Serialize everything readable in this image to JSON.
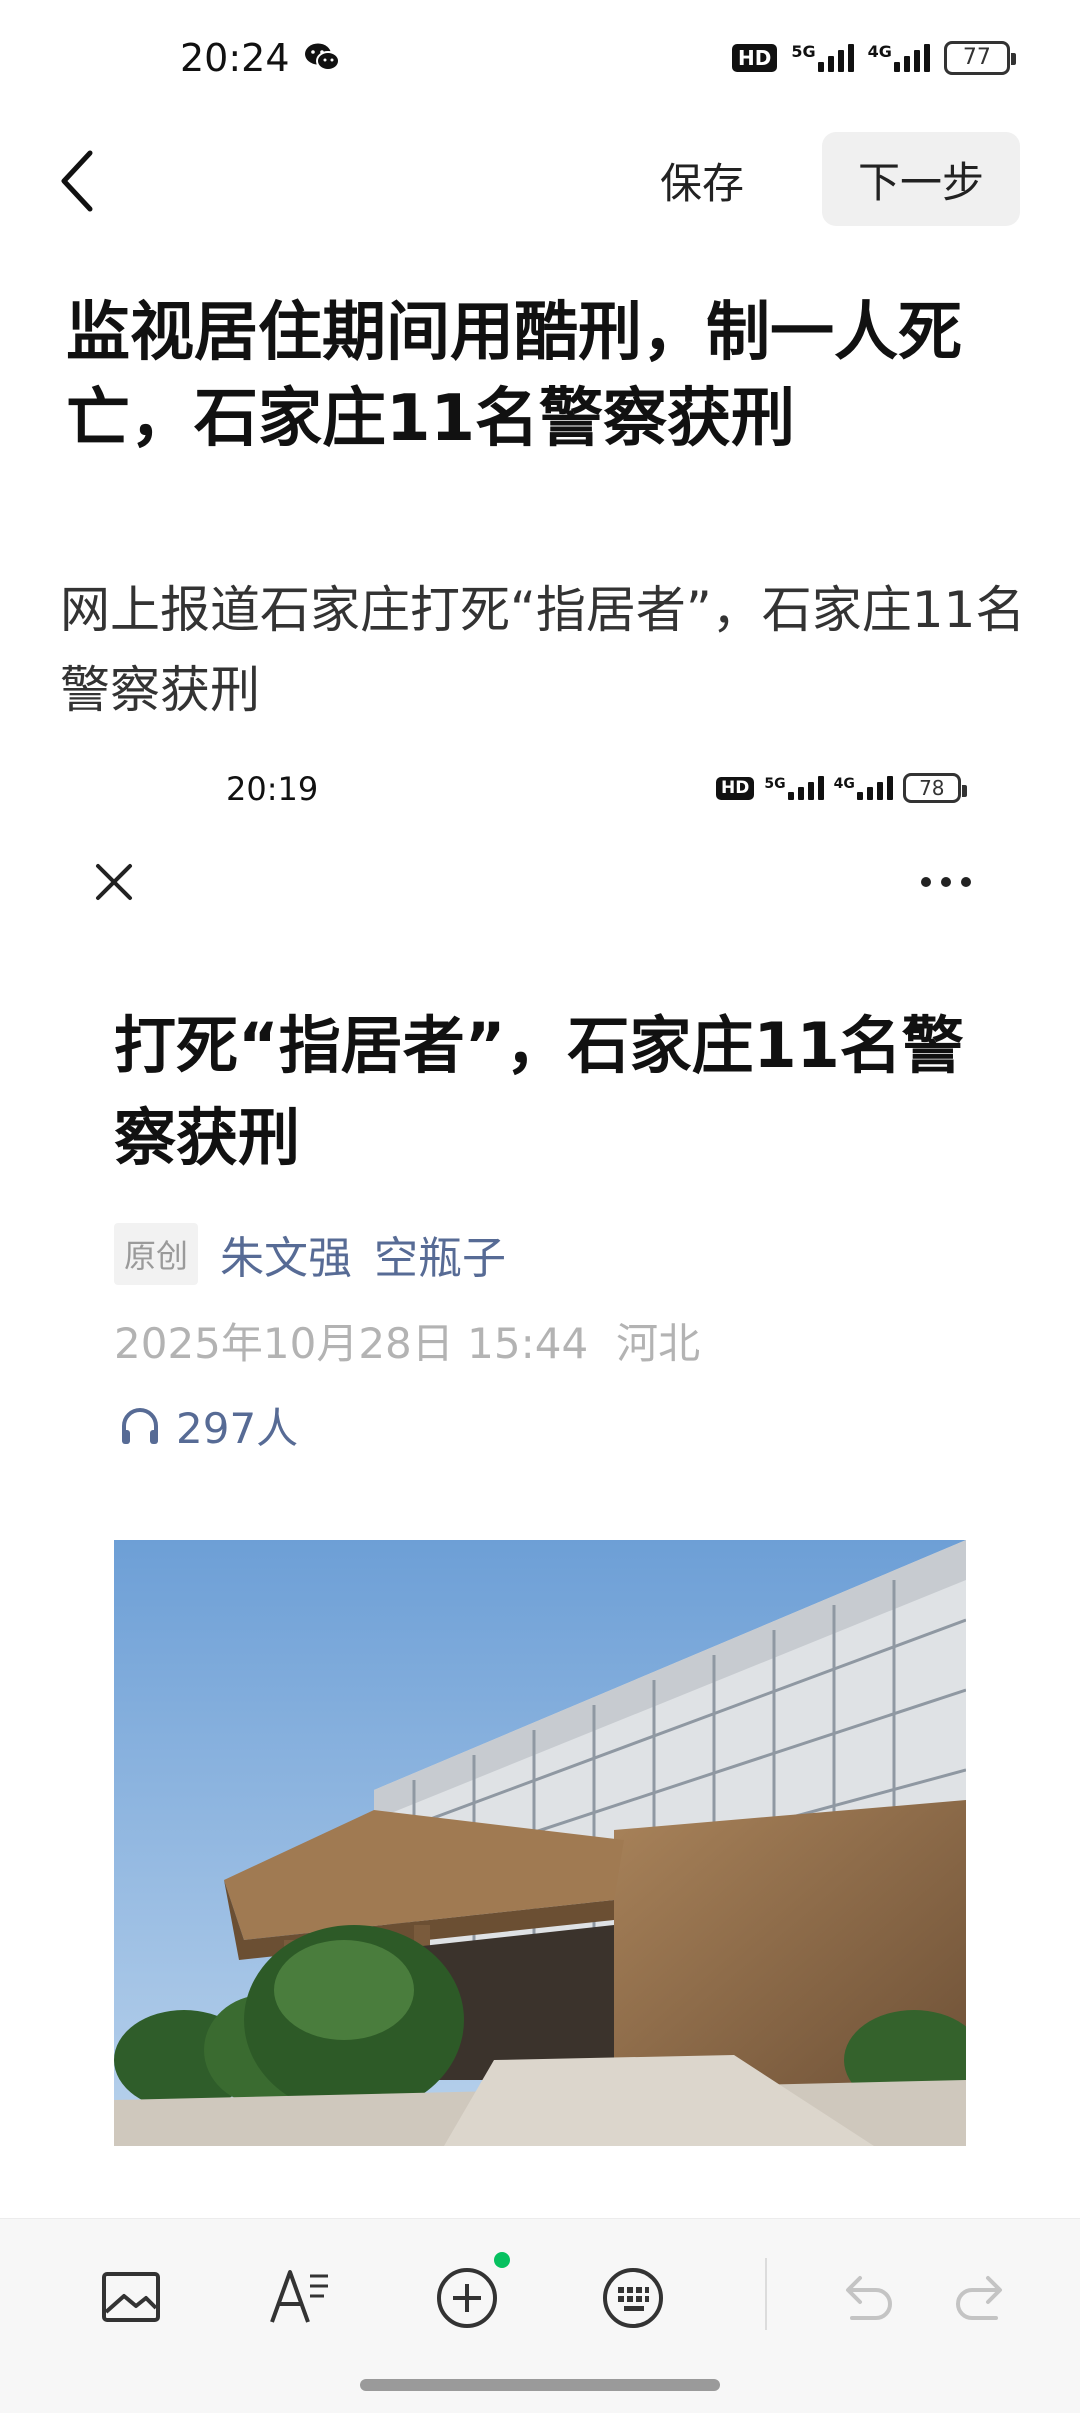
{
  "status_bar": {
    "time": "20:24",
    "hd": "HD",
    "signal_5g": "5G",
    "signal_4g": "4G",
    "battery": "77"
  },
  "header": {
    "save_label": "保存",
    "next_label": "下一步"
  },
  "post": {
    "title": "监视居住期间用酷刑，制一人死亡，石家庄11名警察获刑",
    "body": "网上报道石家庄打死“指居者”，石家庄11名警察获刑"
  },
  "embedded_screenshot": {
    "status_bar": {
      "time": "20:19",
      "hd": "HD",
      "signal_5g": "5G",
      "signal_4g": "4G",
      "battery": "78"
    },
    "article": {
      "title": "打死“指居者”，石家庄11名警察获刑",
      "badge": "原创",
      "authors": [
        "朱文强",
        "空瓶子"
      ],
      "date": "2025年10月28日 15:44",
      "location": "河北",
      "listeners": "297人"
    },
    "photo": {
      "description_icon": "building-photo"
    }
  },
  "toolbar": {
    "items": [
      "image-icon",
      "text-format-icon",
      "add-icon",
      "keyboard-icon",
      "undo-icon",
      "redo-icon"
    ],
    "accent": "#07c160"
  }
}
